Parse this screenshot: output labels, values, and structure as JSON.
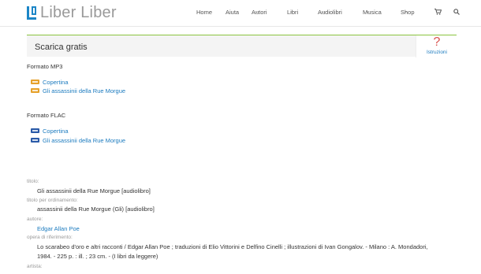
{
  "site": {
    "logo_text": "Liber Liber",
    "colors": {
      "brand_blue": "#1c86c7",
      "accent_green": "#8ac43f",
      "help_red": "#d9534f"
    }
  },
  "nav": {
    "items": [
      {
        "label": "Home",
        "has_dropdown": false
      },
      {
        "label": "Aiuta",
        "has_dropdown": false
      },
      {
        "label": "Autori",
        "has_dropdown": true
      },
      {
        "label": "Libri",
        "has_dropdown": true
      },
      {
        "label": "Audiolibri",
        "has_dropdown": true
      },
      {
        "label": "Musica",
        "has_dropdown": true
      },
      {
        "label": "Shop",
        "has_dropdown": true
      }
    ],
    "cart_icon": "cart-icon",
    "search_icon": "search-icon",
    "chevron": "⌄"
  },
  "download": {
    "title": "Scarica gratis",
    "help_symbol": "?",
    "help_label": "Istruzioni",
    "formats": [
      {
        "label": "Formato MP3",
        "badge": "mp3",
        "files": [
          "Copertina",
          "Gli assassinii della Rue Morgue"
        ]
      },
      {
        "label": "Formato FLAC",
        "badge": "flac",
        "files": [
          "Copertina",
          "Gli assassinii della Rue Morgue"
        ]
      }
    ]
  },
  "metadata": {
    "titolo_label": "titolo:",
    "titolo_value": "Gli assassinii della Rue Morgue [audiolibro]",
    "ordinamento_label": "titolo per ordinamento:",
    "ordinamento_value": "assassinii della Rue Morgue (Gli) [audiolibro]",
    "autore_label": "autore:",
    "autore_value": "Edgar Allan Poe",
    "opera_label": "opera di riferimento:",
    "opera_line1": "Lo scarabeo d'oro e altri racconti / Edgar Allan Poe ; traduzioni di Elio Vittorini e Delfino Cinelli ; illustrazioni di Ivan Gongalov. - Milano : A. Mondadori,",
    "opera_line2": "1984. - 225 p. : ill. ; 23 cm. - (I libri da leggere)",
    "artista_label": "artista:"
  }
}
